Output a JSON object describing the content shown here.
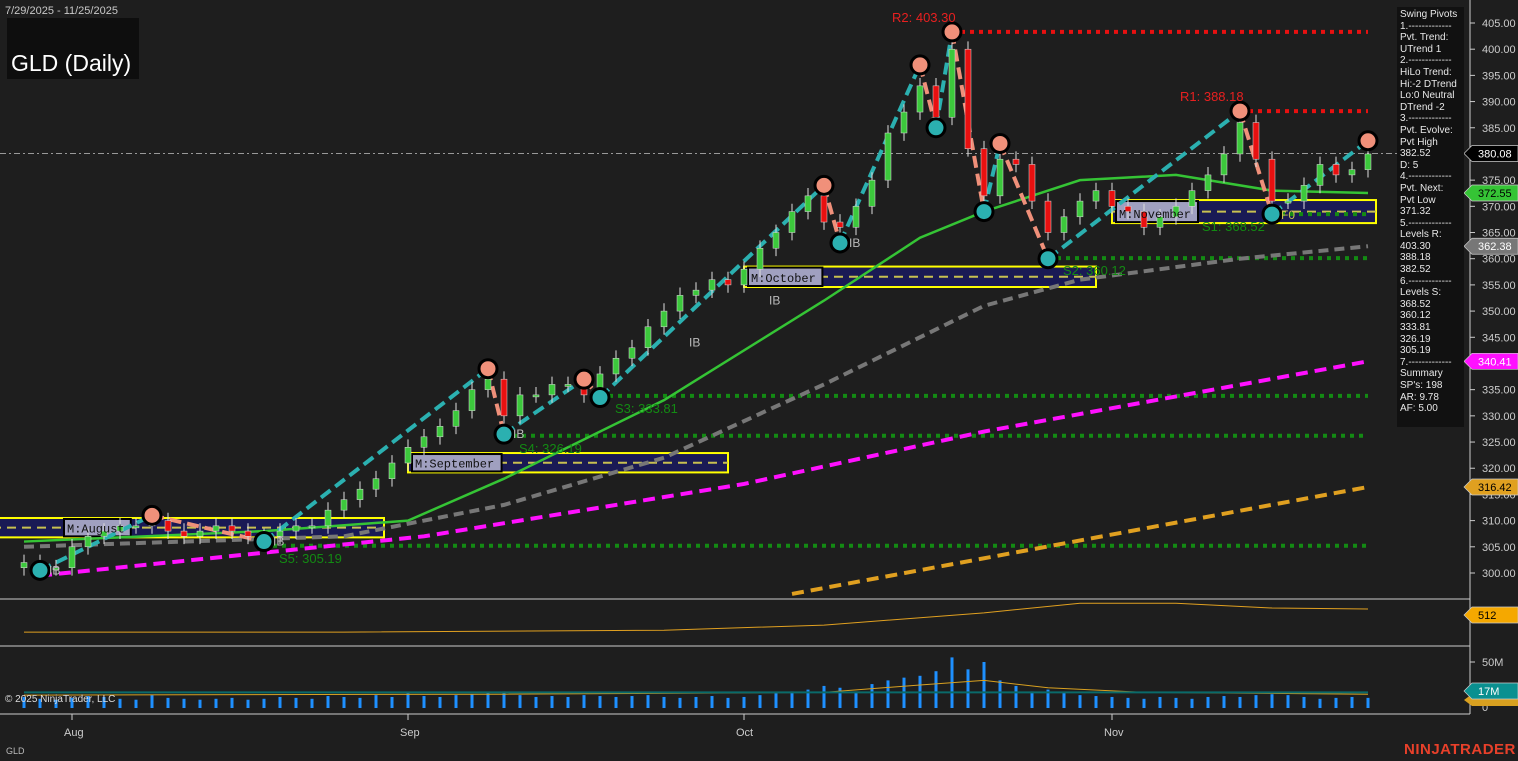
{
  "header": {
    "date_range": "7/29/2025 - 11/25/2025",
    "title": "GLD (Daily)",
    "symbol": "GLD"
  },
  "footer": {
    "copyright": "© 2025 NinjaTrader, LLC",
    "logo": "NINJATRADER"
  },
  "swing_panel": {
    "lines": [
      "Swing Pivots",
      "1.-------------",
      "Pvt. Trend:",
      "UTrend 1",
      "2.-------------",
      "HiLo Trend:",
      "Hi:-2 DTrend",
      "Lo:0 Neutral",
      "DTrend -2",
      "3.-------------",
      "Pvt. Evolve:",
      "Pvt High",
      "382.52",
      "D: 5",
      "4.-------------",
      "Pvt. Next:",
      "Pvt Low",
      "371.32",
      "5.-------------",
      "Levels R:",
      "403.30",
      "388.18",
      "382.52",
      "6.-------------",
      "Levels S:",
      "368.52",
      "360.12",
      "333.81",
      "326.19",
      "305.19",
      "7.-------------",
      "Summary",
      "SP's: 198",
      "AR: 9.78",
      "AF: 5.00"
    ]
  },
  "colors": {
    "bg": "#1e1e1e",
    "up": "#3cc83c",
    "down": "#e81010",
    "green_ma": "#35c435",
    "gray_ma": "#777777",
    "magenta": "#ff10ff",
    "orange": "#e0a020",
    "teal": "#2bb0b0",
    "salmon": "#f0907a",
    "level_r": "#e81010",
    "level_s": "#138a13",
    "zone_fill": "#1a1a55",
    "zone_border": "#ffff00",
    "volume": "#1e90ff"
  },
  "chart_data": {
    "type": "candlestick",
    "title": "GLD (Daily)",
    "ylim": [
      297,
      407
    ],
    "yticks": [
      "405.00",
      "400.00",
      "395.00",
      "390.00",
      "385.00",
      "380.00",
      "375.00",
      "370.00",
      "365.00",
      "360.00",
      "355.00",
      "350.00",
      "345.00",
      "340.00",
      "335.00",
      "330.00",
      "325.00",
      "320.00",
      "315.00",
      "310.00",
      "305.00",
      "300.00"
    ],
    "ytick_values": [
      405,
      400,
      395,
      390,
      385,
      380,
      375,
      370,
      365,
      360,
      355,
      350,
      345,
      340,
      335,
      330,
      325,
      320,
      315,
      310,
      305,
      300
    ],
    "xticks": [
      {
        "label": "Aug",
        "bar": 3
      },
      {
        "label": "Sep",
        "bar": 24
      },
      {
        "label": "Oct",
        "bar": 45
      },
      {
        "label": "Nov",
        "bar": 68
      }
    ],
    "closes": [
      302,
      301,
      301,
      305,
      307,
      308,
      309,
      309,
      310,
      308,
      307,
      308,
      309,
      308,
      307,
      307,
      308,
      309,
      309,
      312,
      314,
      316,
      318,
      321,
      324,
      326,
      328,
      331,
      335,
      337,
      330,
      334,
      334,
      336,
      336,
      334,
      338,
      341,
      343,
      347,
      350,
      353,
      354,
      356,
      355,
      358,
      362,
      365,
      369,
      372,
      367,
      366,
      370,
      375,
      384,
      388,
      393,
      387,
      400,
      381,
      372,
      379,
      378,
      371,
      365,
      368,
      371,
      373,
      370,
      369,
      366,
      368,
      370,
      373,
      376,
      380,
      386,
      379,
      371,
      371,
      374,
      378,
      376,
      377,
      380
    ],
    "ma_series": [
      {
        "name": "green_ma",
        "color": "#35c435",
        "dash": "",
        "points": [
          [
            0,
            306
          ],
          [
            15,
            308
          ],
          [
            24,
            310
          ],
          [
            30,
            318
          ],
          [
            40,
            333
          ],
          [
            50,
            352
          ],
          [
            56,
            364
          ],
          [
            60,
            369
          ],
          [
            66,
            375
          ],
          [
            72,
            376
          ],
          [
            78,
            373
          ],
          [
            84,
            372.55
          ]
        ]
      },
      {
        "name": "gray_ma",
        "color": "#777777",
        "dash": "10 6",
        "points": [
          [
            0,
            305
          ],
          [
            20,
            307
          ],
          [
            30,
            313
          ],
          [
            40,
            322
          ],
          [
            50,
            336
          ],
          [
            60,
            351
          ],
          [
            66,
            356
          ],
          [
            76,
            360
          ],
          [
            84,
            362.38
          ]
        ]
      },
      {
        "name": "magenta_ma",
        "color": "#ff10ff",
        "dash": "12 7",
        "points": [
          [
            1,
            299.5
          ],
          [
            25,
            307
          ],
          [
            45,
            317
          ],
          [
            60,
            327
          ],
          [
            84,
            340.41
          ]
        ]
      },
      {
        "name": "orange_ma",
        "color": "#e0a020",
        "dash": "12 7",
        "points": [
          [
            48,
            296
          ],
          [
            84,
            316.42
          ]
        ]
      }
    ],
    "pivots": [
      [
        1,
        300.5,
        "L"
      ],
      [
        8,
        311,
        "H"
      ],
      [
        15,
        306,
        "L"
      ],
      [
        29,
        339,
        "H"
      ],
      [
        30,
        326.5,
        "L"
      ],
      [
        35,
        337,
        "H"
      ],
      [
        36,
        333.5,
        "L"
      ],
      [
        50,
        374,
        "H"
      ],
      [
        51,
        363,
        "L"
      ],
      [
        56,
        397,
        "H"
      ],
      [
        57,
        385,
        "L"
      ],
      [
        58,
        403.3,
        "H"
      ],
      [
        60,
        369,
        "L"
      ],
      [
        61,
        382,
        "H"
      ],
      [
        64,
        360,
        "L"
      ],
      [
        76,
        388.18,
        "H"
      ],
      [
        78,
        368.52,
        "L"
      ],
      [
        84,
        382.52,
        "H"
      ]
    ],
    "levels": [
      {
        "label": "R2: 403.30",
        "value": 403.3,
        "from": 58,
        "kind": "R"
      },
      {
        "label": "R1: 388.18",
        "value": 388.18,
        "from": 76,
        "kind": "R"
      },
      {
        "label": "S1: 368.52",
        "value": 368.52,
        "from": 78,
        "kind": "S"
      },
      {
        "label": "S2: 360.12",
        "value": 360.12,
        "from": 64,
        "kind": "S"
      },
      {
        "label": "S3: 333.81",
        "value": 333.81,
        "from": 36,
        "kind": "S"
      },
      {
        "label": "S4: 326.19",
        "value": 326.19,
        "from": 30,
        "kind": "S"
      },
      {
        "label": "S5: 305.19",
        "value": 305.19,
        "from": 15,
        "kind": "S"
      }
    ],
    "zones": [
      {
        "label": "M:August",
        "from": -2,
        "to": 22.5,
        "top": 310.5,
        "bottom": 306.8
      },
      {
        "label": "M:September",
        "from": 24,
        "to": 44,
        "top": 322.9,
        "bottom": 319.2
      },
      {
        "label": "M:October",
        "from": 45,
        "to": 67,
        "top": 358.5,
        "bottom": 354.6
      },
      {
        "label": "M:November",
        "from": 68,
        "to": 84.5,
        "top": 371.2,
        "bottom": 366.8
      }
    ],
    "last_price": 380.08,
    "price_tags": [
      {
        "label": "380.08",
        "value": 380.08,
        "bg": "#000000",
        "fg": "#ffffff"
      },
      {
        "label": "372.55",
        "value": 372.55,
        "bg": "#35c435",
        "fg": "#000000"
      },
      {
        "label": "362.38",
        "value": 362.38,
        "bg": "#777777",
        "fg": "#ffffff"
      },
      {
        "label": "340.41",
        "value": 340.41,
        "bg": "#ff10ff",
        "fg": "#ffffff"
      },
      {
        "label": "316.42",
        "value": 316.42,
        "bg": "#e0a020",
        "fg": "#000000"
      }
    ],
    "markers": [
      "IB",
      "IB",
      "IB",
      "IB",
      "IB",
      "IB",
      "F0"
    ],
    "indicator": {
      "label": "512",
      "value": 512,
      "ylim": [
        400,
        540
      ],
      "points": [
        [
          0,
          440
        ],
        [
          20,
          440
        ],
        [
          40,
          446
        ],
        [
          50,
          462
        ],
        [
          60,
          500
        ],
        [
          66,
          530
        ],
        [
          72,
          530
        ],
        [
          78,
          515
        ],
        [
          84,
          512
        ]
      ]
    },
    "volume": {
      "label": "17M",
      "tick_50": "50M",
      "tick_0": "0",
      "ylim": [
        0,
        60
      ],
      "values": [
        12,
        10,
        9,
        11,
        13,
        12,
        10,
        9,
        14,
        11,
        10,
        9,
        10,
        11,
        9,
        10,
        12,
        11,
        10,
        13,
        12,
        11,
        14,
        12,
        16,
        13,
        12,
        14,
        15,
        17,
        18,
        14,
        12,
        13,
        12,
        14,
        13,
        12,
        13,
        14,
        12,
        11,
        12,
        13,
        11,
        12,
        14,
        16,
        18,
        20,
        24,
        22,
        18,
        26,
        30,
        33,
        35,
        40,
        55,
        42,
        50,
        30,
        24,
        18,
        20,
        17,
        14,
        13,
        12,
        11,
        10,
        12,
        11,
        10,
        12,
        13,
        12,
        14,
        15,
        14,
        12,
        10,
        11,
        12,
        11
      ],
      "avg": [
        [
          0,
          14
        ],
        [
          30,
          15
        ],
        [
          50,
          17
        ],
        [
          56,
          25
        ],
        [
          60,
          30
        ],
        [
          64,
          22
        ],
        [
          70,
          17
        ],
        [
          84,
          15
        ]
      ]
    }
  }
}
